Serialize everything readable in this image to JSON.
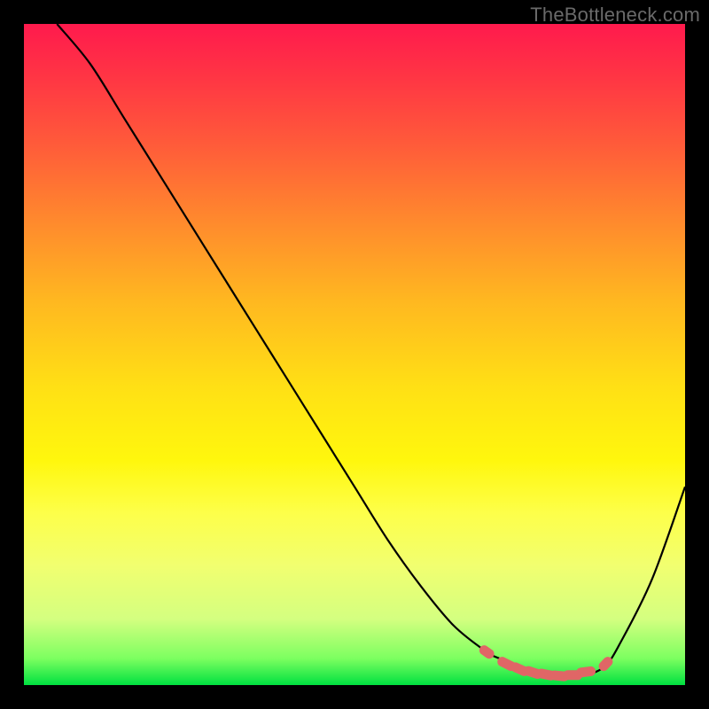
{
  "watermark": "TheBottleneck.com",
  "colors": {
    "frame": "#000000",
    "gradient_top": "#ff1a4d",
    "gradient_bottom": "#00e040",
    "curve": "#000000",
    "markers": "#e06666"
  },
  "chart_data": {
    "type": "line",
    "title": "",
    "xlabel": "",
    "ylabel": "",
    "xlim": [
      0,
      100
    ],
    "ylim": [
      0,
      100
    ],
    "grid": false,
    "x": [
      5,
      10,
      15,
      20,
      25,
      30,
      35,
      40,
      45,
      50,
      55,
      60,
      65,
      70,
      72,
      74,
      76,
      78,
      80,
      82,
      84,
      86,
      88,
      90,
      95,
      100
    ],
    "values": [
      100,
      94,
      86,
      78,
      70,
      62,
      54,
      46,
      38,
      30,
      22,
      15,
      9,
      5,
      4,
      3,
      2.2,
      1.7,
      1.4,
      1.3,
      1.4,
      1.8,
      3,
      6,
      16,
      30
    ],
    "markers_x": [
      70,
      73,
      75,
      77,
      79,
      81,
      83,
      85,
      88
    ],
    "markers_y": [
      5,
      3.2,
      2.4,
      1.9,
      1.6,
      1.4,
      1.5,
      2.0,
      3.2
    ],
    "legend": false,
    "note": "Values are percentage of full-scale; y measured from bottom of plot area. Estimates read from curve position against gradient bands."
  }
}
